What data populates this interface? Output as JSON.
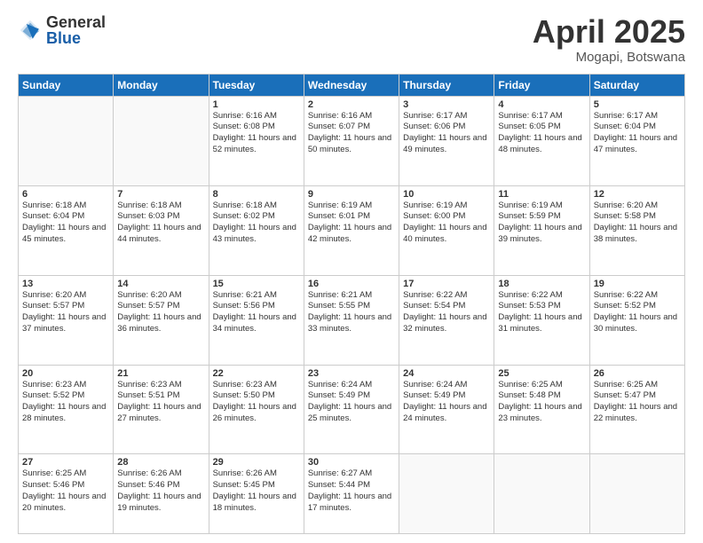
{
  "header": {
    "logo_general": "General",
    "logo_blue": "Blue",
    "month_title": "April 2025",
    "location": "Mogapi, Botswana"
  },
  "weekdays": [
    "Sunday",
    "Monday",
    "Tuesday",
    "Wednesday",
    "Thursday",
    "Friday",
    "Saturday"
  ],
  "weeks": [
    [
      {
        "day": "",
        "text": ""
      },
      {
        "day": "",
        "text": ""
      },
      {
        "day": "1",
        "text": "Sunrise: 6:16 AM\nSunset: 6:08 PM\nDaylight: 11 hours and 52 minutes."
      },
      {
        "day": "2",
        "text": "Sunrise: 6:16 AM\nSunset: 6:07 PM\nDaylight: 11 hours and 50 minutes."
      },
      {
        "day": "3",
        "text": "Sunrise: 6:17 AM\nSunset: 6:06 PM\nDaylight: 11 hours and 49 minutes."
      },
      {
        "day": "4",
        "text": "Sunrise: 6:17 AM\nSunset: 6:05 PM\nDaylight: 11 hours and 48 minutes."
      },
      {
        "day": "5",
        "text": "Sunrise: 6:17 AM\nSunset: 6:04 PM\nDaylight: 11 hours and 47 minutes."
      }
    ],
    [
      {
        "day": "6",
        "text": "Sunrise: 6:18 AM\nSunset: 6:04 PM\nDaylight: 11 hours and 45 minutes."
      },
      {
        "day": "7",
        "text": "Sunrise: 6:18 AM\nSunset: 6:03 PM\nDaylight: 11 hours and 44 minutes."
      },
      {
        "day": "8",
        "text": "Sunrise: 6:18 AM\nSunset: 6:02 PM\nDaylight: 11 hours and 43 minutes."
      },
      {
        "day": "9",
        "text": "Sunrise: 6:19 AM\nSunset: 6:01 PM\nDaylight: 11 hours and 42 minutes."
      },
      {
        "day": "10",
        "text": "Sunrise: 6:19 AM\nSunset: 6:00 PM\nDaylight: 11 hours and 40 minutes."
      },
      {
        "day": "11",
        "text": "Sunrise: 6:19 AM\nSunset: 5:59 PM\nDaylight: 11 hours and 39 minutes."
      },
      {
        "day": "12",
        "text": "Sunrise: 6:20 AM\nSunset: 5:58 PM\nDaylight: 11 hours and 38 minutes."
      }
    ],
    [
      {
        "day": "13",
        "text": "Sunrise: 6:20 AM\nSunset: 5:57 PM\nDaylight: 11 hours and 37 minutes."
      },
      {
        "day": "14",
        "text": "Sunrise: 6:20 AM\nSunset: 5:57 PM\nDaylight: 11 hours and 36 minutes."
      },
      {
        "day": "15",
        "text": "Sunrise: 6:21 AM\nSunset: 5:56 PM\nDaylight: 11 hours and 34 minutes."
      },
      {
        "day": "16",
        "text": "Sunrise: 6:21 AM\nSunset: 5:55 PM\nDaylight: 11 hours and 33 minutes."
      },
      {
        "day": "17",
        "text": "Sunrise: 6:22 AM\nSunset: 5:54 PM\nDaylight: 11 hours and 32 minutes."
      },
      {
        "day": "18",
        "text": "Sunrise: 6:22 AM\nSunset: 5:53 PM\nDaylight: 11 hours and 31 minutes."
      },
      {
        "day": "19",
        "text": "Sunrise: 6:22 AM\nSunset: 5:52 PM\nDaylight: 11 hours and 30 minutes."
      }
    ],
    [
      {
        "day": "20",
        "text": "Sunrise: 6:23 AM\nSunset: 5:52 PM\nDaylight: 11 hours and 28 minutes."
      },
      {
        "day": "21",
        "text": "Sunrise: 6:23 AM\nSunset: 5:51 PM\nDaylight: 11 hours and 27 minutes."
      },
      {
        "day": "22",
        "text": "Sunrise: 6:23 AM\nSunset: 5:50 PM\nDaylight: 11 hours and 26 minutes."
      },
      {
        "day": "23",
        "text": "Sunrise: 6:24 AM\nSunset: 5:49 PM\nDaylight: 11 hours and 25 minutes."
      },
      {
        "day": "24",
        "text": "Sunrise: 6:24 AM\nSunset: 5:49 PM\nDaylight: 11 hours and 24 minutes."
      },
      {
        "day": "25",
        "text": "Sunrise: 6:25 AM\nSunset: 5:48 PM\nDaylight: 11 hours and 23 minutes."
      },
      {
        "day": "26",
        "text": "Sunrise: 6:25 AM\nSunset: 5:47 PM\nDaylight: 11 hours and 22 minutes."
      }
    ],
    [
      {
        "day": "27",
        "text": "Sunrise: 6:25 AM\nSunset: 5:46 PM\nDaylight: 11 hours and 20 minutes."
      },
      {
        "day": "28",
        "text": "Sunrise: 6:26 AM\nSunset: 5:46 PM\nDaylight: 11 hours and 19 minutes."
      },
      {
        "day": "29",
        "text": "Sunrise: 6:26 AM\nSunset: 5:45 PM\nDaylight: 11 hours and 18 minutes."
      },
      {
        "day": "30",
        "text": "Sunrise: 6:27 AM\nSunset: 5:44 PM\nDaylight: 11 hours and 17 minutes."
      },
      {
        "day": "",
        "text": ""
      },
      {
        "day": "",
        "text": ""
      },
      {
        "day": "",
        "text": ""
      }
    ]
  ]
}
